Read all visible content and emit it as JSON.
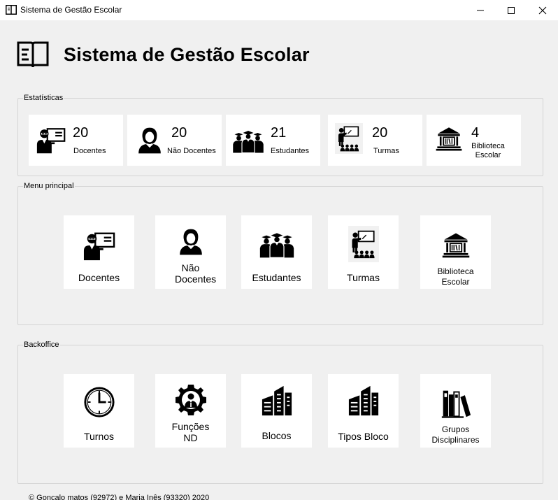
{
  "window": {
    "title": "Sistema de Gestão Escolar"
  },
  "header": {
    "title": "Sistema de Gestão Escolar",
    "icon": "book-icon"
  },
  "stats": {
    "group_label": "Estatísticas",
    "items": [
      {
        "value": "20",
        "label": "Docentes",
        "icon": "teacher-icon"
      },
      {
        "value": "20",
        "label": "Não Docentes",
        "icon": "staff-person-icon"
      },
      {
        "value": "21",
        "label": "Estudantes",
        "icon": "students-graduates-icon"
      },
      {
        "value": "20",
        "label": "Turmas",
        "icon": "classroom-icon"
      },
      {
        "value": "4",
        "label": "Biblioteca Escolar",
        "icon": "library-building-icon"
      }
    ]
  },
  "menu": {
    "group_label": "Menu principal",
    "items": [
      {
        "label": "Docentes",
        "icon": "teacher-icon"
      },
      {
        "label": "Não Docentes",
        "icon": "staff-person-icon"
      },
      {
        "label": "Estudantes",
        "icon": "students-graduates-icon"
      },
      {
        "label": "Turmas",
        "icon": "classroom-icon"
      },
      {
        "label": "Biblioteca Escolar",
        "icon": "library-building-icon"
      }
    ]
  },
  "backoffice": {
    "group_label": "Backoffice",
    "items": [
      {
        "label": "Turnos",
        "icon": "clock-icon"
      },
      {
        "label": "Funções ND",
        "icon": "gear-person-icon"
      },
      {
        "label": "Blocos",
        "icon": "buildings-icon"
      },
      {
        "label": "Tipos Bloco",
        "icon": "buildings-icon"
      },
      {
        "label": "Grupos Disciplinares",
        "icon": "books-icon"
      }
    ]
  },
  "footer": {
    "text": "© Gonçalo matos (92972) e Maria Inês (93320) 2020"
  }
}
